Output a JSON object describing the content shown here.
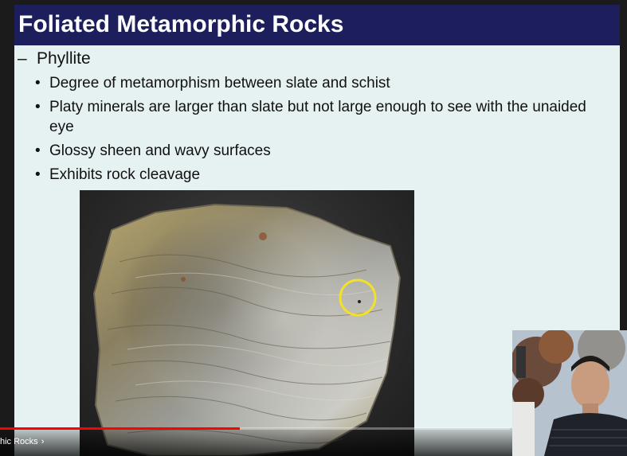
{
  "slide": {
    "title": "Foliated Metamorphic Rocks",
    "main_bullet": {
      "marker": "–",
      "text": "Phyllite"
    },
    "sub_bullets": [
      "Degree of metamorphism between slate and schist",
      "Platy minerals are larger than slate but not large enough to see with the unaided eye",
      "Glossy sheen and wavy surfaces",
      "Exhibits rock cleavage"
    ],
    "bullet_glyph": "•"
  },
  "player": {
    "chapter_label": "hic Rocks",
    "chapter_chevron": "›",
    "progress": 0.47,
    "progress_color": "#ff0000"
  },
  "colors": {
    "title_bar": "#1c1f5c",
    "slide_bg": "#e6f1f1",
    "highlight_ring": "#f2e02a"
  }
}
